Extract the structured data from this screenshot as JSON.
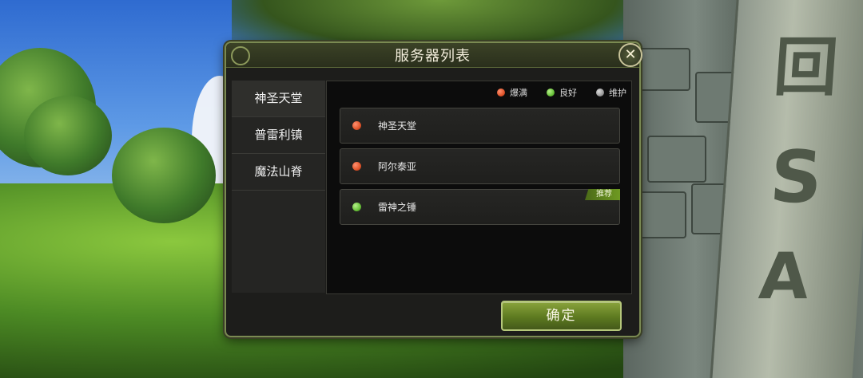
{
  "dialog": {
    "title": "服务器列表",
    "close_icon": "close-icon",
    "confirm_label": "确定"
  },
  "regions": [
    {
      "label": "神圣天堂",
      "active": true
    },
    {
      "label": "普雷利镇",
      "active": false
    },
    {
      "label": "魔法山脊",
      "active": false
    }
  ],
  "legend": [
    {
      "label": "爆满",
      "color": "#e0542a"
    },
    {
      "label": "良好",
      "color": "#69c23a"
    },
    {
      "label": "维护",
      "color": "#9a9a9a"
    }
  ],
  "servers": [
    {
      "name": "神圣天堂",
      "status_color": "#e0542a",
      "badge": ""
    },
    {
      "name": "阿尔泰亚",
      "status_color": "#e0542a",
      "badge": ""
    },
    {
      "name": "雷神之锤",
      "status_color": "#69c23a",
      "badge": "推荐"
    }
  ],
  "pillar_glyphs": [
    "回",
    "S",
    "A"
  ]
}
